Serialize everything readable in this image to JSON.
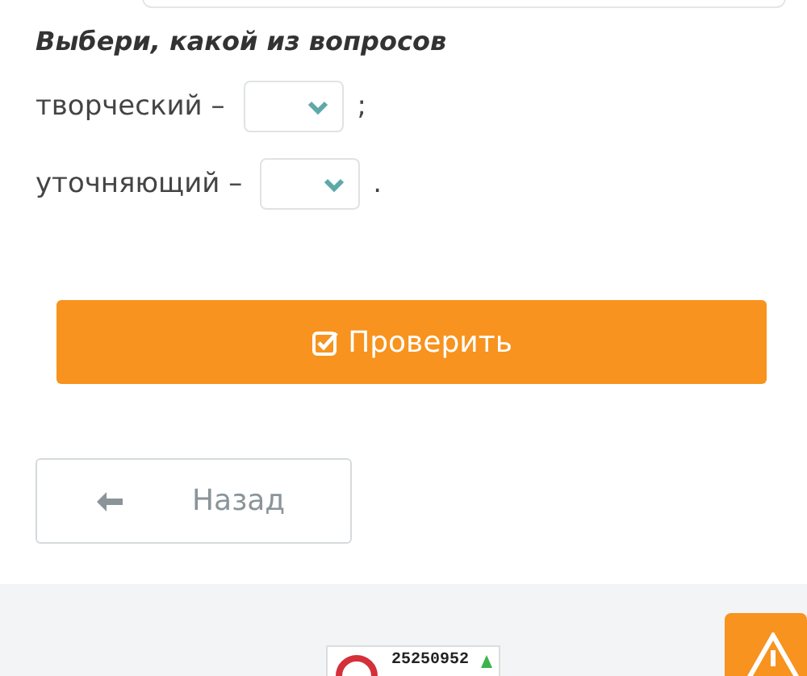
{
  "question": {
    "title": "Выбери, какой из вопросов",
    "rows": [
      {
        "label": "творческий –",
        "punctuation": ";"
      },
      {
        "label": "уточняющий –",
        "punctuation": "."
      }
    ]
  },
  "check_button": {
    "label": "Проверить"
  },
  "back_button": {
    "label": "Назад"
  },
  "footer": {
    "counter": "25250952"
  }
}
